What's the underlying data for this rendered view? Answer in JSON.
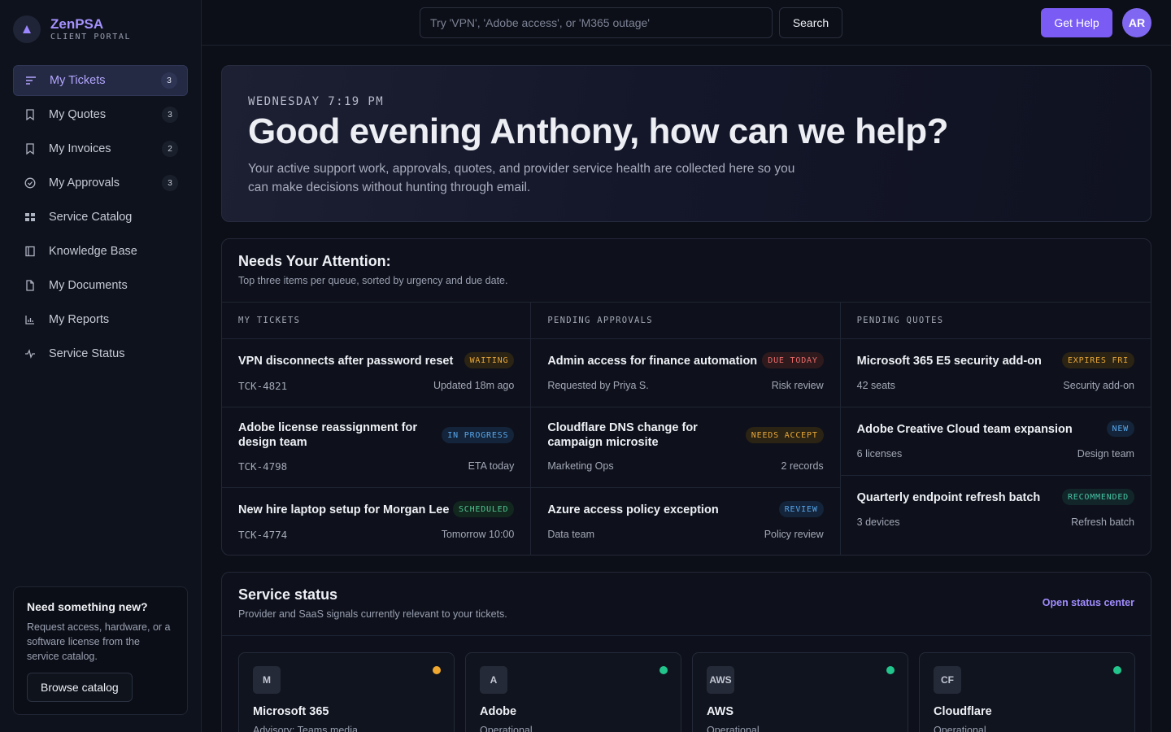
{
  "brand": {
    "name": "ZenPSA",
    "subtitle": "CLIENT PORTAL",
    "accent": "#a592ff"
  },
  "sidebar": {
    "items": [
      {
        "label": "My Tickets",
        "count": "3",
        "icon": "list-icon",
        "active": true
      },
      {
        "label": "My Quotes",
        "count": "3",
        "icon": "bookmark-icon"
      },
      {
        "label": "My Invoices",
        "count": "2",
        "icon": "bookmark-icon"
      },
      {
        "label": "My Approvals",
        "count": "3",
        "icon": "check-circle-icon"
      },
      {
        "label": "Service Catalog",
        "icon": "grid-icon"
      },
      {
        "label": "Knowledge Base",
        "icon": "book-icon"
      },
      {
        "label": "My Documents",
        "icon": "file-icon"
      },
      {
        "label": "My Reports",
        "icon": "bar-chart-icon"
      },
      {
        "label": "Service Status",
        "icon": "activity-icon"
      }
    ],
    "promo": {
      "title": "Need something new?",
      "text": "Request access, hardware, or a software license from the service catalog.",
      "button": "Browse catalog"
    }
  },
  "topbar": {
    "search_placeholder": "Try 'VPN', 'Adobe access', or 'M365 outage'",
    "search_button": "Search",
    "help_button": "Get Help",
    "avatar_initials": "AR"
  },
  "hero": {
    "time": "WEDNESDAY 7:19 PM",
    "title": "Good evening Anthony, how can we help?",
    "text": "Your active support work, approvals, quotes, and provider service health are collected here so you can make decisions without hunting through email."
  },
  "attention": {
    "title": "Needs Your Attention:",
    "subtitle": "Top three items per queue, sorted by urgency and due date.",
    "columns": [
      {
        "heading": "MY TICKETS",
        "items": [
          {
            "title": "VPN disconnects after password reset",
            "badge": "WAITING",
            "badge_color": "#e7a83a",
            "meta_left": "TCK-4821",
            "meta_right": "Updated 18m ago"
          },
          {
            "title": "Adobe license reassignment for design team",
            "badge": "IN PROGRESS",
            "badge_color": "#57a7ec",
            "meta_left": "TCK-4798",
            "meta_right": "ETA today"
          },
          {
            "title": "New hire laptop setup for Morgan Lee",
            "badge": "SCHEDULED",
            "badge_color": "#4fc58f",
            "meta_left": "TCK-4774",
            "meta_right": "Tomorrow 10:00"
          }
        ]
      },
      {
        "heading": "PENDING APPROVALS",
        "items": [
          {
            "title": "Admin access for finance automation",
            "badge": "DUE TODAY",
            "badge_color": "#e86a6a",
            "meta_left": "Requested by Priya S.",
            "meta_right": "Risk review"
          },
          {
            "title": "Cloudflare DNS change for campaign microsite",
            "badge": "NEEDS ACCEPT",
            "badge_color": "#e7a83a",
            "meta_left": "Marketing Ops",
            "meta_right": "2 records"
          },
          {
            "title": "Azure access policy exception",
            "badge": "REVIEW",
            "badge_color": "#57a7ec",
            "meta_left": "Data team",
            "meta_right": "Policy review"
          }
        ]
      },
      {
        "heading": "PENDING QUOTES",
        "items": [
          {
            "title": "Microsoft 365 E5 security add-on",
            "badge": "EXPIRES FRI",
            "badge_color": "#e7a83a",
            "meta_left": "42 seats",
            "meta_right": "Security add-on"
          },
          {
            "title": "Adobe Creative Cloud team expansion",
            "badge": "NEW",
            "badge_color": "#57a7ec",
            "meta_left": "6 licenses",
            "meta_right": "Design team"
          },
          {
            "title": "Quarterly endpoint refresh batch",
            "badge": "RECOMMENDED",
            "badge_color": "#45c4a4",
            "meta_left": "3 devices",
            "meta_right": "Refresh batch"
          }
        ]
      }
    ]
  },
  "service_status": {
    "title": "Service status",
    "subtitle": "Provider and SaaS signals currently relevant to your tickets.",
    "link": "Open status center",
    "cards": [
      {
        "logo": "M",
        "name": "Microsoft 365",
        "state": "Advisory: Teams media",
        "dot_color": "#f0a92e"
      },
      {
        "logo": "A",
        "name": "Adobe",
        "state": "Operational",
        "dot_color": "#22c58b"
      },
      {
        "logo": "AWS",
        "name": "AWS",
        "state": "Operational",
        "dot_color": "#22c58b"
      },
      {
        "logo": "CF",
        "name": "Cloudflare",
        "state": "Operational",
        "dot_color": "#22c58b"
      }
    ]
  }
}
